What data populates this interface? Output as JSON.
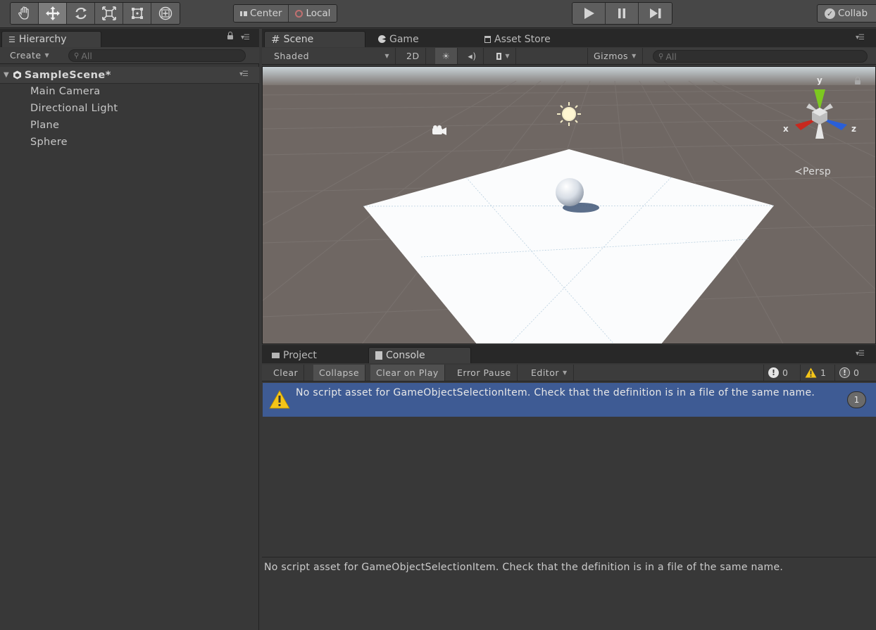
{
  "toolbar": {
    "tools": [
      "hand-tool-icon",
      "move-tool-icon",
      "rotate-tool-icon",
      "scale-tool-icon",
      "rect-tool-icon",
      "transform-tool-icon"
    ],
    "active_tool": "move-tool-icon",
    "pivot_label": "Center",
    "space_label": "Local",
    "collab_label": "Collab"
  },
  "hierarchy": {
    "tab_label": "Hierarchy",
    "create_label": "Create",
    "search_placeholder": "All",
    "scene_name": "SampleScene*",
    "items": [
      "Main Camera",
      "Directional Light",
      "Plane",
      "Sphere"
    ]
  },
  "scene": {
    "tabs": [
      "Scene",
      "Game",
      "Asset Store"
    ],
    "active_tab": "Scene",
    "shading_mode": "Shaded",
    "mode_2d_label": "2D",
    "gizmos_label": "Gizmos",
    "search_placeholder": "All",
    "projection_label": "Persp",
    "axis_labels": {
      "y": "y",
      "x": "x",
      "z": "z"
    }
  },
  "console": {
    "tabs": [
      "Project",
      "Console"
    ],
    "active_tab": "Console",
    "buttons": [
      "Clear",
      "Collapse",
      "Clear on Play",
      "Error Pause",
      "Editor"
    ],
    "pressed": [
      "Collapse",
      "Clear on Play"
    ],
    "error_count": "0",
    "warning_count": "1",
    "info_count": "0",
    "log_entries": [
      {
        "type": "warning",
        "text": "No script asset for GameObjectSelectionItem. Check that the definition is in a file of the same name.",
        "count": "1"
      }
    ],
    "detail_text": "No script asset for GameObjectSelectionItem. Check that the definition is in a file of the same name."
  },
  "colors": {
    "selected_row": "#3e5b94",
    "warning": "#f5c518",
    "axis_x": "#c8281e",
    "axis_y": "#7dc820",
    "axis_z": "#2a5fd8"
  }
}
